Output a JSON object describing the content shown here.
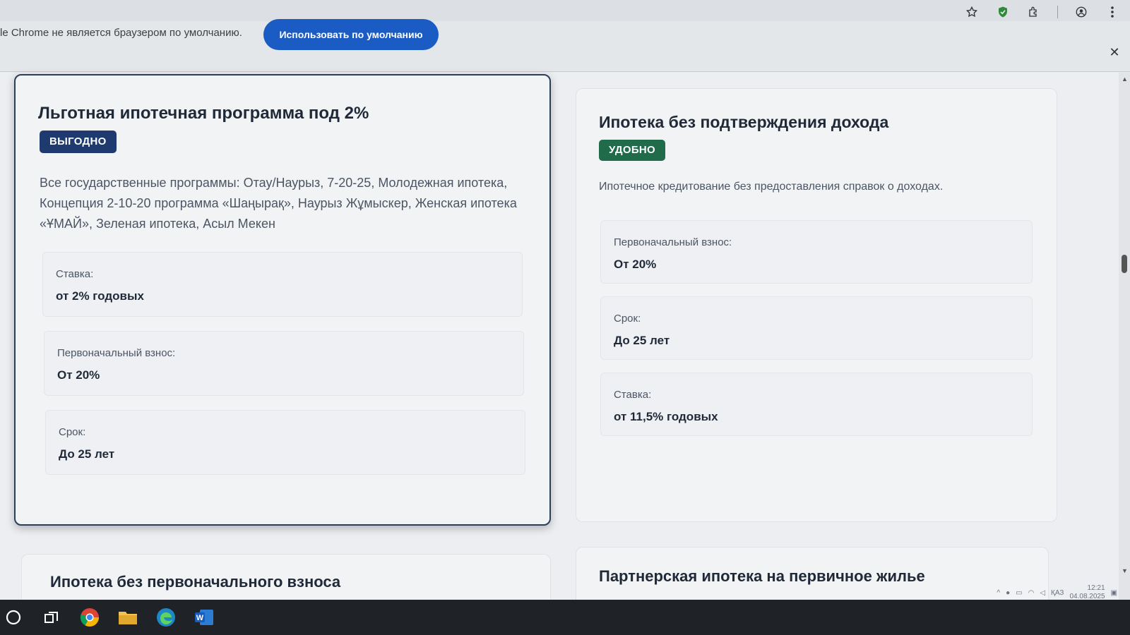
{
  "infobar": {
    "message": "le Chrome не является браузером по умолчанию.",
    "default_button": "Использовать по умолчанию"
  },
  "cards": [
    {
      "title": "Льготная ипотечная программа под 2%",
      "badge": "ВЫГОДНО",
      "badge_color": "#1e3a6e",
      "description": "Все государственные программы: Отау/Наурыз, 7-20-25, Молодежная ипотека, Концепция 2-10-20 программа «Шаңырақ», Наурыз Жұмыскер, Женская ипотека «ҰМАЙ», Зеленая ипотека, Асыл Мекен",
      "items": [
        {
          "label": "Ставка:",
          "value": "от 2% годовых"
        },
        {
          "label": "Первоначальный взнос:",
          "value": "От 20%"
        },
        {
          "label": "Срок:",
          "value": "До 25 лет"
        }
      ]
    },
    {
      "title": "Ипотека без подтверждения дохода",
      "badge": "УДОБНО",
      "badge_color": "#1f6b4a",
      "description": "Ипотечное кредитование без предоставления справок о доходах.",
      "items": [
        {
          "label": "Первоначальный взнос:",
          "value": "От 20%"
        },
        {
          "label": "Срок:",
          "value": "До 25 лет"
        },
        {
          "label": "Ставка:",
          "value": "от 11,5% годовых"
        }
      ]
    }
  ],
  "bottom_cards": [
    {
      "title": "Ипотека без первоначального взноса"
    },
    {
      "title": "Партнерская ипотека на первичное жилье"
    }
  ],
  "tray": {
    "language": "ҚАЗ",
    "time": "12:21",
    "date": "04.08.2025"
  },
  "icons": {
    "toolbar": [
      "star-icon",
      "shield-icon",
      "extensions-icon",
      "profile-icon",
      "menu-icon"
    ],
    "taskbar": [
      "search-icon",
      "task-view-icon",
      "chrome-icon",
      "file-explorer-icon",
      "edge-icon",
      "word-icon"
    ]
  }
}
